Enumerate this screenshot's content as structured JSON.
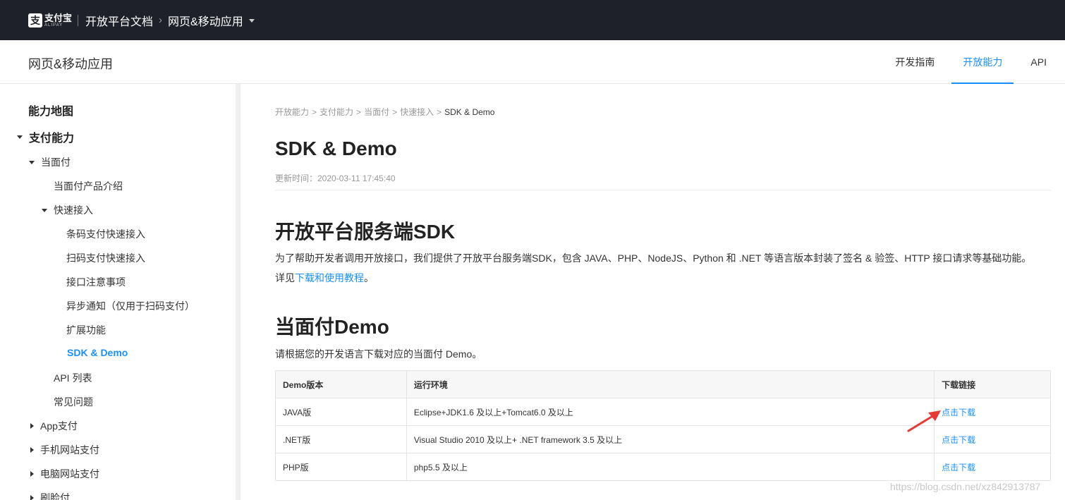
{
  "topbar": {
    "logo_cn": "支付宝",
    "logo_en": "ALIPAY",
    "docs_title": "开放平台文档",
    "section": "网页&移动应用"
  },
  "subheader": {
    "title": "网页&移动应用",
    "nav": [
      {
        "label": "开发指南",
        "active": false
      },
      {
        "label": "开放能力",
        "active": true
      },
      {
        "label": "API",
        "active": false
      }
    ]
  },
  "sidebar": {
    "items": [
      {
        "label": "能力地图"
      },
      {
        "label": "支付能力"
      },
      {
        "label": "当面付"
      },
      {
        "label": "当面付产品介绍"
      },
      {
        "label": "快速接入"
      },
      {
        "label": "条码支付快速接入"
      },
      {
        "label": "扫码支付快速接入"
      },
      {
        "label": "接口注意事项"
      },
      {
        "label": "异步通知（仅用于扫码支付）"
      },
      {
        "label": "扩展功能"
      },
      {
        "label": "SDK & Demo"
      },
      {
        "label": "API 列表"
      },
      {
        "label": "常见问题"
      },
      {
        "label": "App支付"
      },
      {
        "label": "手机网站支付"
      },
      {
        "label": "电脑网站支付"
      },
      {
        "label": "刷脸付"
      }
    ]
  },
  "main": {
    "breadcrumb": [
      "开放能力",
      "支付能力",
      "当面付",
      "快速接入",
      "SDK & Demo"
    ],
    "breadcrumb_sep": ">",
    "title": "SDK & Demo",
    "updated": "更新时间：2020-03-11 17:45:40",
    "sdk_heading": "开放平台服务端SDK",
    "sdk_para": "为了帮助开发者调用开放接口，我们提供了开放平台服务端SDK，包含 JAVA、PHP、NodeJS、Python 和 .NET 等语言版本封装了签名 & 验签、HTTP 接口请求等基础功能。",
    "sdk_more_prefix": "详见",
    "sdk_more_link": "下载和使用教程",
    "sdk_more_suffix": "。",
    "demo_heading": "当面付Demo",
    "demo_para": "请根据您的开发语言下载对应的当面付 Demo。",
    "table": {
      "headers": [
        "Demo版本",
        "运行环境",
        "下载链接"
      ],
      "rows": [
        [
          "JAVA版",
          "Eclipse+JDK1.6 及以上+Tomcat6.0 及以上",
          "点击下载"
        ],
        [
          ".NET版",
          "Visual Studio 2010 及以上+ .NET framework 3.5 及以上",
          "点击下载"
        ],
        [
          "PHP版",
          "php5.5 及以上",
          "点击下载"
        ]
      ]
    }
  },
  "watermark": "https://blog.csdn.net/xz842913787",
  "colors": {
    "topbar_bg": "#1e2129",
    "accent": "#1890ff",
    "arrow": "#e53935"
  }
}
